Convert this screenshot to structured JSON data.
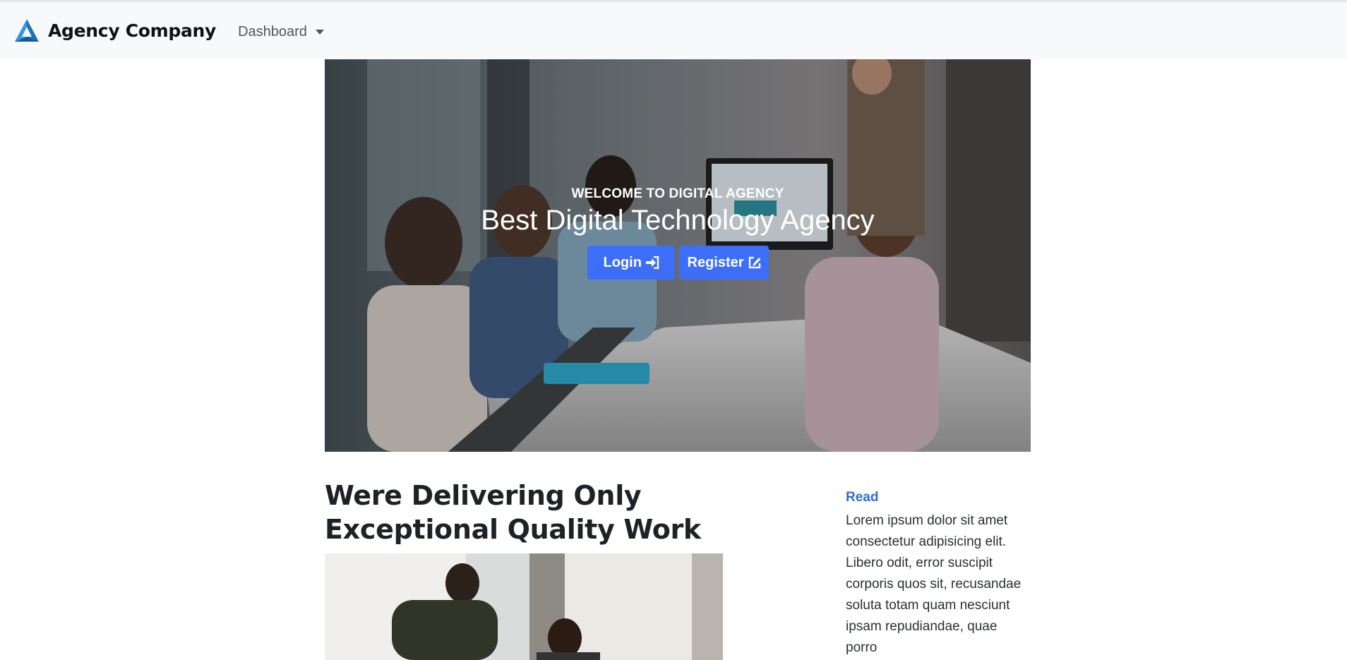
{
  "navbar": {
    "brand_name": "Agency Company",
    "dashboard_label": "Dashboard",
    "background": "#f8f9fa"
  },
  "hero": {
    "kicker": "WELCOME TO DIGITAL AGENCY",
    "title": "Best Digital Technology Agency",
    "login_label": "Login",
    "register_label": "Register",
    "button_color": "#3d6ef7",
    "login_icon": "sign-in-icon",
    "register_icon": "edit-icon"
  },
  "section": {
    "title": "Were Delivering Only Exceptional Quality Work"
  },
  "aside": {
    "link_label": "Read",
    "text": "Lorem ipsum dolor sit amet consectetur adipisicing elit. Libero odit, error suscipit corporis quos sit, recusandae soluta totam quam nesciunt ipsam repudiandae, quae porro"
  }
}
